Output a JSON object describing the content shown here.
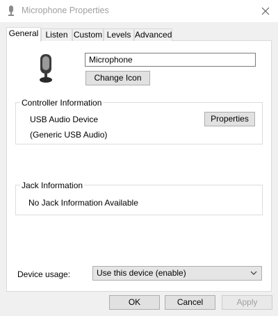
{
  "window": {
    "title": "Microphone Properties",
    "close_icon": "close-icon",
    "title_icon": "microphone-icon"
  },
  "tabs": [
    {
      "label": "General",
      "active": true
    },
    {
      "label": "Listen",
      "active": false
    },
    {
      "label": "Custom",
      "active": false
    },
    {
      "label": "Levels",
      "active": false
    },
    {
      "label": "Advanced",
      "active": false
    }
  ],
  "general": {
    "device_name_value": "Microphone",
    "change_icon_label": "Change Icon",
    "controller": {
      "title": "Controller Information",
      "device": "USB Audio Device",
      "driver": "(Generic USB Audio)",
      "properties_label": "Properties"
    },
    "jack": {
      "title": "Jack Information",
      "status": "No Jack Information Available"
    },
    "device_usage": {
      "label": "Device usage:",
      "selected": "Use this device (enable)"
    }
  },
  "footer": {
    "ok_label": "OK",
    "cancel_label": "Cancel",
    "apply_label": "Apply"
  },
  "colors": {
    "window_bg": "#f0f0f0",
    "panel_bg": "#ffffff",
    "disabled_text": "#a0a0a0",
    "button_bg": "#e1e1e1"
  }
}
